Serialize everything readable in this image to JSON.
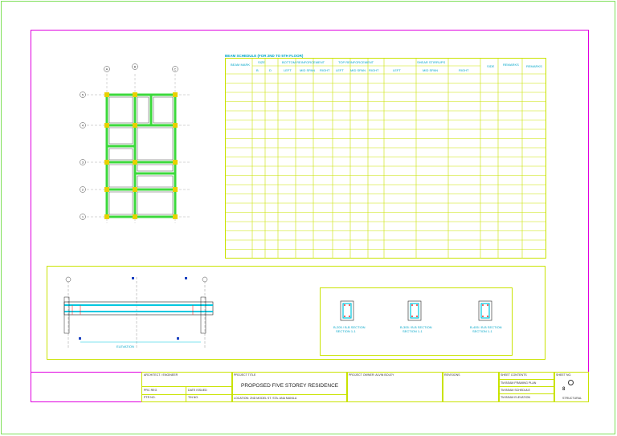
{
  "sheet": {
    "frame_color": "#e000e0",
    "accent_green": "#c8e000",
    "struct_green": "#3cd93c",
    "cyan": "#00b4d8"
  },
  "schedule": {
    "title": "BEAM SCHEDULE (FOR 2ND TO 5TH FLOOR)",
    "headers": {
      "beam_mark": "BEAM MARK",
      "size": "SIZE",
      "b": "B",
      "d": "D",
      "bottom": "BOTTOM REINFORCEMENT",
      "top": "TOP REINFORCEMENT",
      "stirrups": "SHEAR STIRRUPS",
      "left": "LEFT",
      "mid": "MID SPAN",
      "right": "RIGHT",
      "side": "SIDE",
      "remarks": "REMARKS",
      "remarks2": "REMARKS"
    }
  },
  "grid": {
    "letters": [
      "A",
      "B",
      "C"
    ],
    "numbers": [
      "1",
      "2",
      "3",
      "4",
      "5"
    ]
  },
  "sections": {
    "elevation_caption": "ELEVATION",
    "items": [
      {
        "title": "B-205 / B-B SECTION",
        "sub": "SECTION 1-1"
      },
      {
        "title": "B-305 / B-B SECTION",
        "sub": "SECTION 1-1"
      },
      {
        "title": "B-405 / B-B SECTION",
        "sub": "SECTION 1-1"
      }
    ]
  },
  "title_block": {
    "architect": "ARCHITECT / ENGINEER",
    "prc_reg": "PRC REG",
    "ptr_no": "PTR NO.",
    "date_issued": "DATE ISSUED",
    "tin_no": "TIN NO.",
    "project_title_lbl": "PROJECT TITLE",
    "project_title": "PROPOSED FIVE STOREY RESIDENCE",
    "location": "LOCATION: 2ND MODEL ST. STA. ANA MANILA",
    "owner": "PROJECT OWNER: ALVIN BOLEY",
    "revisions": "REVISIONS",
    "sheet_contents_lbl": "SHEET CONTENTS",
    "contents": [
      "TM BEAM FRAMING PLAN",
      "TM BEAM SCHEDULE",
      "TM BEAM ELEVATION"
    ],
    "sheet_no_lbl": "SHEET NO.",
    "sheet_no": "8",
    "discipline": "STRUCTURAL"
  }
}
